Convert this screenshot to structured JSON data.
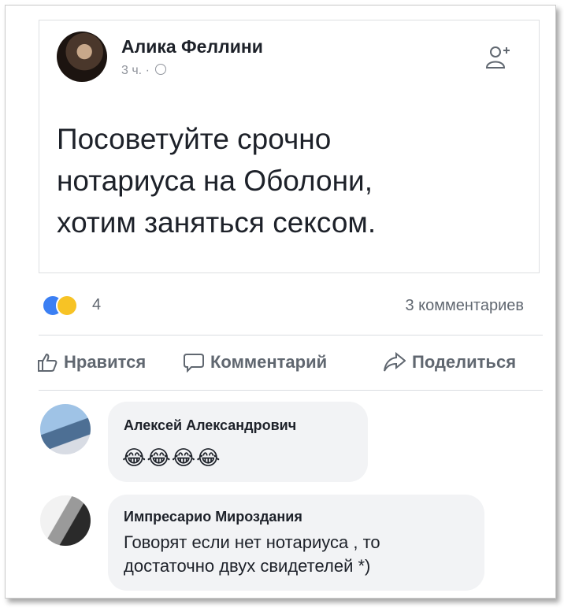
{
  "post": {
    "author": "Алика Феллини",
    "time": "3 ч. ·",
    "text": "Посоветуйте срочно\nнотариуса на Оболони,\nхотим заняться сексом."
  },
  "reactions": {
    "count": "4",
    "comments": "3 комментариев",
    "icons": [
      "like-icon",
      "haha-icon"
    ]
  },
  "actions": {
    "like": "Нравится",
    "comment": "Комментарий",
    "share": "Поделиться"
  },
  "comments": [
    {
      "name": "Алексей Александрович",
      "text": "😂😂😂😂"
    },
    {
      "name": "Импресарио Мироздания",
      "text": "Говорят если нет нотариуса , то\nдостаточно двух свидетелей *)"
    }
  ],
  "colors": {
    "accent": "#3b7ff3",
    "muted": "#606770",
    "bubble": "#f2f3f5"
  }
}
